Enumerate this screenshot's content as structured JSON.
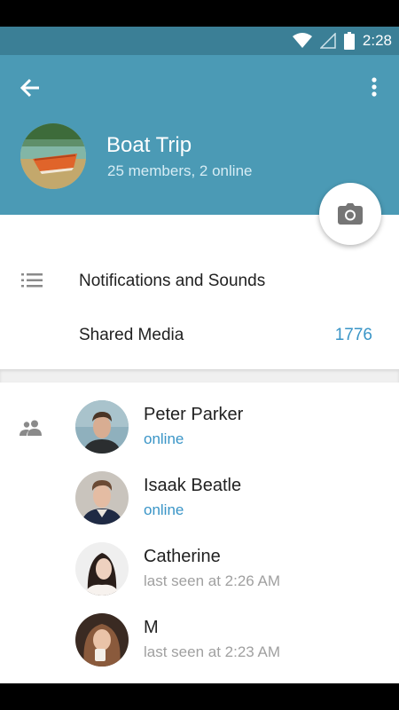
{
  "status_bar": {
    "time": "2:28",
    "icons": [
      "wifi-icon",
      "signal-icon",
      "battery-icon"
    ]
  },
  "header": {
    "title": "Boat Trip",
    "subtitle": "25 members, 2 online",
    "background": "#4b9ab5",
    "icons": [
      "back-arrow-icon",
      "more-vertical-icon",
      "camera-icon"
    ]
  },
  "settings": {
    "notifications_label": "Notifications and Sounds",
    "shared_media_label": "Shared Media",
    "shared_media_count": "1776",
    "icons": [
      "list-icon"
    ]
  },
  "members": {
    "icon": "group-icon",
    "items": [
      {
        "name": "Peter Parker",
        "status": "online"
      },
      {
        "name": "Isaak Beatle",
        "status": "online"
      },
      {
        "name": "Catherine",
        "status": "last seen at 2:26 AM"
      },
      {
        "name": "M",
        "status": "last seen at 2:23 AM"
      }
    ]
  },
  "colors": {
    "accent": "#3a95c7",
    "statusbar": "#3b7f96"
  }
}
